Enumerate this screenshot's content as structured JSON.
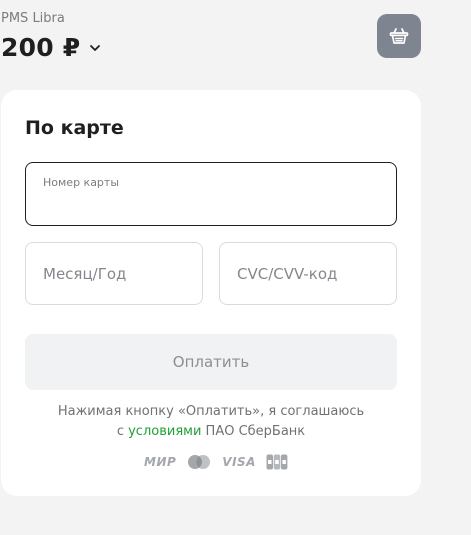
{
  "header": {
    "merchant_name": "PMS Libra",
    "amount": "200 ₽",
    "amount_chevron_icon": "chevron-down-icon",
    "cart_icon": "basket-icon",
    "cart_button_color": "#7e8490"
  },
  "payment_form": {
    "title": "По карте",
    "card_number_label": "Номер карты",
    "card_number_value": "",
    "expiry_placeholder": "Месяц/Год",
    "cvc_placeholder": "CVC/CVV-код",
    "pay_button_label": "Оплатить",
    "pay_button_enabled": false
  },
  "agreement": {
    "text_before": "Нажимая кнопку «Оплатить», я соглашаюсь",
    "text_prefix": "с ",
    "link_label": "условиями",
    "text_after": " ПАО СберБанк",
    "link_color": "#21a038"
  },
  "payment_systems": [
    {
      "name": "mir-logo",
      "label": "МИР"
    },
    {
      "name": "mastercard-logo",
      "label": ""
    },
    {
      "name": "visa-logo",
      "label": "VISA"
    },
    {
      "name": "jcb-logo",
      "label": ""
    }
  ]
}
